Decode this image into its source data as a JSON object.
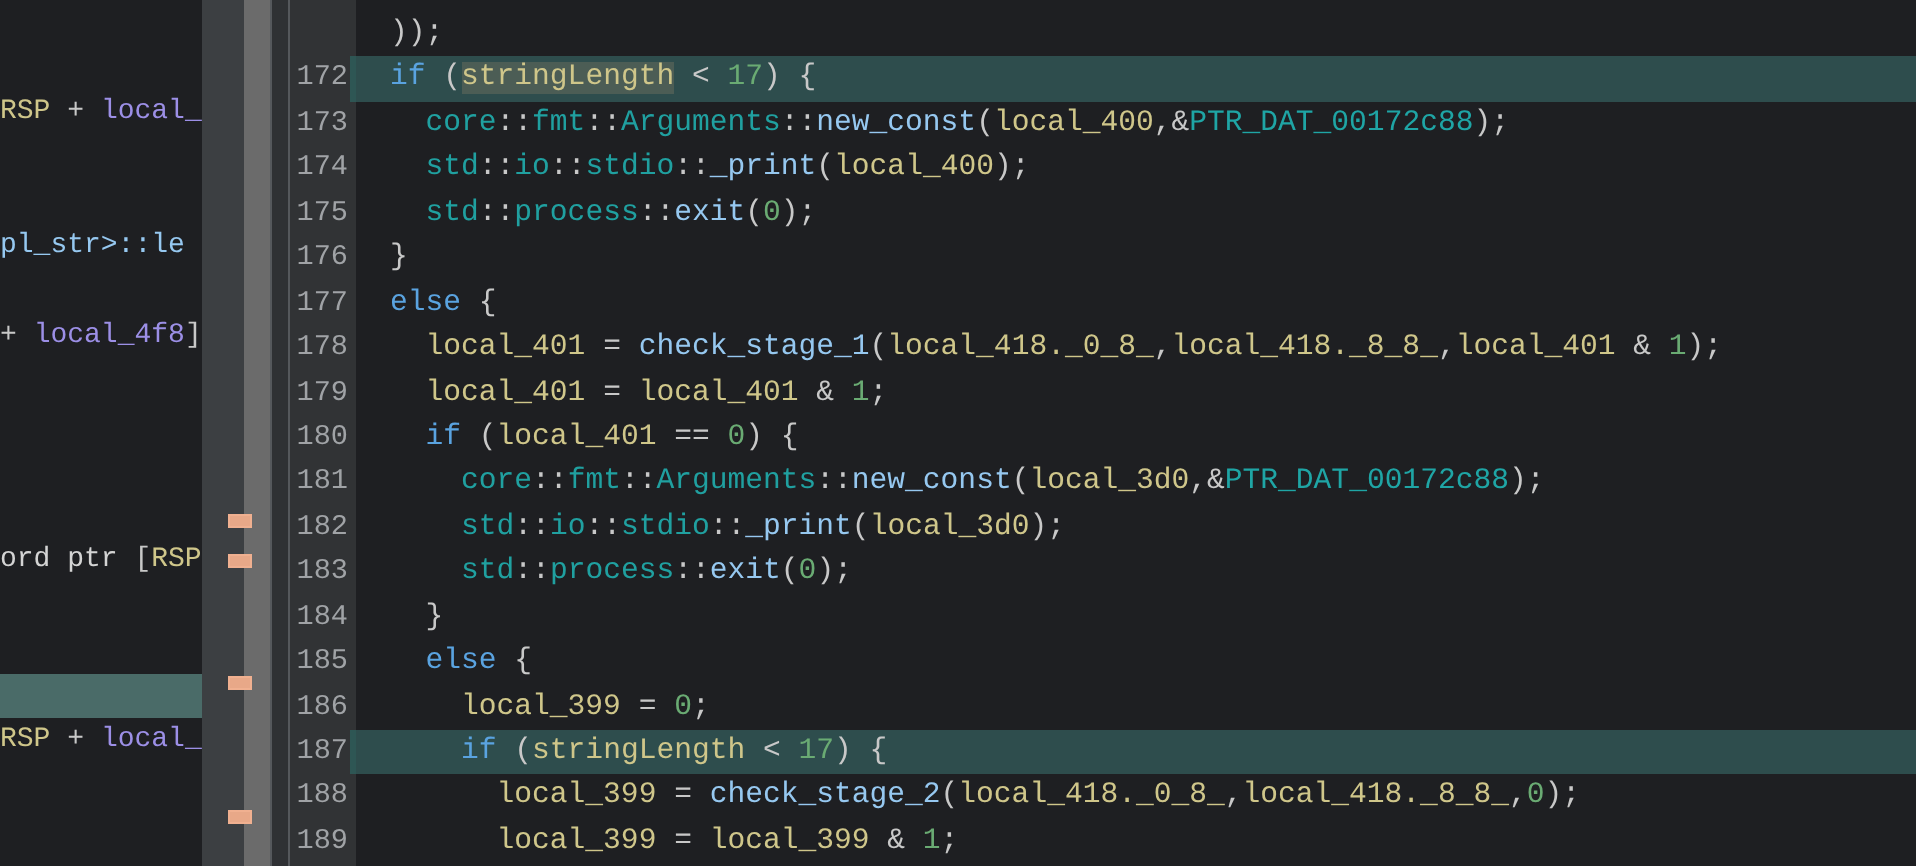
{
  "listing": {
    "rows": [
      {
        "kind": "blank"
      },
      {
        "kind": "blank"
      },
      {
        "kind": "code",
        "highlighted": false,
        "tokens": [
          {
            "text": "RSP",
            "kind": "register"
          },
          {
            "text": " + ",
            "kind": "punct"
          },
          {
            "text": "local_",
            "kind": "field"
          }
        ]
      },
      {
        "kind": "blank"
      },
      {
        "kind": "blank"
      },
      {
        "kind": "code",
        "highlighted": false,
        "tokens": [
          {
            "text": "pl_str>::le",
            "kind": "function"
          }
        ]
      },
      {
        "kind": "blank"
      },
      {
        "kind": "code",
        "highlighted": false,
        "tokens": [
          {
            "text": "+ ",
            "kind": "punct"
          },
          {
            "text": "local_4f8",
            "kind": "field"
          },
          {
            "text": "]",
            "kind": "punct"
          }
        ]
      },
      {
        "kind": "blank"
      },
      {
        "kind": "blank"
      },
      {
        "kind": "blank"
      },
      {
        "kind": "blank"
      },
      {
        "kind": "code",
        "highlighted": false,
        "tokens": [
          {
            "text": "ord ptr ",
            "kind": "plain"
          },
          {
            "text": "[",
            "kind": "punct"
          },
          {
            "text": "RSP",
            "kind": "register"
          }
        ]
      },
      {
        "kind": "blank"
      },
      {
        "kind": "blank"
      },
      {
        "kind": "blank",
        "highlighted": true
      },
      {
        "kind": "code",
        "highlighted": false,
        "tokens": [
          {
            "text": "RSP",
            "kind": "register"
          },
          {
            "text": " + ",
            "kind": "punct"
          },
          {
            "text": "local_",
            "kind": "field"
          }
        ]
      },
      {
        "kind": "blank"
      },
      {
        "kind": "blank"
      }
    ]
  },
  "decompiler": {
    "lines": [
      {
        "highlighted": false,
        "tokens": [
          {
            "text": "));",
            "kind": "punct"
          }
        ]
      },
      {
        "number": "172",
        "highlighted": true,
        "tokens": [
          {
            "text": "if",
            "kind": "keyword"
          },
          {
            "text": " (",
            "kind": "punct"
          },
          {
            "text": "stringLength",
            "kind": "variable",
            "marked": true
          },
          {
            "text": " < ",
            "kind": "punct"
          },
          {
            "text": "17",
            "kind": "number"
          },
          {
            "text": ") {",
            "kind": "punct"
          }
        ]
      },
      {
        "number": "173",
        "highlighted": false,
        "tokens": [
          {
            "text": "  core",
            "kind": "namespace"
          },
          {
            "text": "::",
            "kind": "punct"
          },
          {
            "text": "fmt",
            "kind": "namespace"
          },
          {
            "text": "::",
            "kind": "punct"
          },
          {
            "text": "Arguments",
            "kind": "namespace"
          },
          {
            "text": "::",
            "kind": "punct"
          },
          {
            "text": "new_const",
            "kind": "function"
          },
          {
            "text": "(",
            "kind": "punct"
          },
          {
            "text": "local_400",
            "kind": "variable"
          },
          {
            "text": ",&",
            "kind": "punct"
          },
          {
            "text": "PTR_DAT_00172c88",
            "kind": "constant"
          },
          {
            "text": ");",
            "kind": "punct"
          }
        ]
      },
      {
        "number": "174",
        "highlighted": false,
        "tokens": [
          {
            "text": "  std",
            "kind": "namespace"
          },
          {
            "text": "::",
            "kind": "punct"
          },
          {
            "text": "io",
            "kind": "namespace"
          },
          {
            "text": "::",
            "kind": "punct"
          },
          {
            "text": "stdio",
            "kind": "namespace"
          },
          {
            "text": "::",
            "kind": "punct"
          },
          {
            "text": "_print",
            "kind": "function"
          },
          {
            "text": "(",
            "kind": "punct"
          },
          {
            "text": "local_400",
            "kind": "variable"
          },
          {
            "text": ");",
            "kind": "punct"
          }
        ]
      },
      {
        "number": "175",
        "highlighted": false,
        "tokens": [
          {
            "text": "  std",
            "kind": "namespace"
          },
          {
            "text": "::",
            "kind": "punct"
          },
          {
            "text": "process",
            "kind": "namespace"
          },
          {
            "text": "::",
            "kind": "punct"
          },
          {
            "text": "exit",
            "kind": "function"
          },
          {
            "text": "(",
            "kind": "punct"
          },
          {
            "text": "0",
            "kind": "number"
          },
          {
            "text": ");",
            "kind": "punct"
          }
        ]
      },
      {
        "number": "176",
        "highlighted": false,
        "tokens": [
          {
            "text": "}",
            "kind": "punct"
          }
        ]
      },
      {
        "number": "177",
        "highlighted": false,
        "tokens": [
          {
            "text": "else",
            "kind": "keyword"
          },
          {
            "text": " {",
            "kind": "punct"
          }
        ]
      },
      {
        "number": "178",
        "highlighted": false,
        "tokens": [
          {
            "text": "  local_401",
            "kind": "variable"
          },
          {
            "text": " = ",
            "kind": "punct"
          },
          {
            "text": "check_stage_1",
            "kind": "function"
          },
          {
            "text": "(",
            "kind": "punct"
          },
          {
            "text": "local_418._0_8_",
            "kind": "variable"
          },
          {
            "text": ",",
            "kind": "punct"
          },
          {
            "text": "local_418._8_8_",
            "kind": "variable"
          },
          {
            "text": ",",
            "kind": "punct"
          },
          {
            "text": "local_401",
            "kind": "variable"
          },
          {
            "text": " & ",
            "kind": "punct"
          },
          {
            "text": "1",
            "kind": "number"
          },
          {
            "text": ");",
            "kind": "punct"
          }
        ]
      },
      {
        "number": "179",
        "highlighted": false,
        "tokens": [
          {
            "text": "  local_401",
            "kind": "variable"
          },
          {
            "text": " = ",
            "kind": "punct"
          },
          {
            "text": "local_401",
            "kind": "variable"
          },
          {
            "text": " & ",
            "kind": "punct"
          },
          {
            "text": "1",
            "kind": "number"
          },
          {
            "text": ";",
            "kind": "punct"
          }
        ]
      },
      {
        "number": "180",
        "highlighted": false,
        "tokens": [
          {
            "text": "  if",
            "kind": "keyword"
          },
          {
            "text": " (",
            "kind": "punct"
          },
          {
            "text": "local_401",
            "kind": "variable"
          },
          {
            "text": " == ",
            "kind": "punct"
          },
          {
            "text": "0",
            "kind": "number"
          },
          {
            "text": ") {",
            "kind": "punct"
          }
        ]
      },
      {
        "number": "181",
        "highlighted": false,
        "tokens": [
          {
            "text": "    core",
            "kind": "namespace"
          },
          {
            "text": "::",
            "kind": "punct"
          },
          {
            "text": "fmt",
            "kind": "namespace"
          },
          {
            "text": "::",
            "kind": "punct"
          },
          {
            "text": "Arguments",
            "kind": "namespace"
          },
          {
            "text": "::",
            "kind": "punct"
          },
          {
            "text": "new_const",
            "kind": "function"
          },
          {
            "text": "(",
            "kind": "punct"
          },
          {
            "text": "local_3d0",
            "kind": "variable"
          },
          {
            "text": ",&",
            "kind": "punct"
          },
          {
            "text": "PTR_DAT_00172c88",
            "kind": "constant"
          },
          {
            "text": ");",
            "kind": "punct"
          }
        ]
      },
      {
        "number": "182",
        "highlighted": false,
        "tokens": [
          {
            "text": "    std",
            "kind": "namespace"
          },
          {
            "text": "::",
            "kind": "punct"
          },
          {
            "text": "io",
            "kind": "namespace"
          },
          {
            "text": "::",
            "kind": "punct"
          },
          {
            "text": "stdio",
            "kind": "namespace"
          },
          {
            "text": "::",
            "kind": "punct"
          },
          {
            "text": "_print",
            "kind": "function"
          },
          {
            "text": "(",
            "kind": "punct"
          },
          {
            "text": "local_3d0",
            "kind": "variable"
          },
          {
            "text": ");",
            "kind": "punct"
          }
        ]
      },
      {
        "number": "183",
        "highlighted": false,
        "tokens": [
          {
            "text": "    std",
            "kind": "namespace"
          },
          {
            "text": "::",
            "kind": "punct"
          },
          {
            "text": "process",
            "kind": "namespace"
          },
          {
            "text": "::",
            "kind": "punct"
          },
          {
            "text": "exit",
            "kind": "function"
          },
          {
            "text": "(",
            "kind": "punct"
          },
          {
            "text": "0",
            "kind": "number"
          },
          {
            "text": ");",
            "kind": "punct"
          }
        ]
      },
      {
        "number": "184",
        "highlighted": false,
        "tokens": [
          {
            "text": "  }",
            "kind": "punct"
          }
        ]
      },
      {
        "number": "185",
        "highlighted": false,
        "tokens": [
          {
            "text": "  else",
            "kind": "keyword"
          },
          {
            "text": " {",
            "kind": "punct"
          }
        ]
      },
      {
        "number": "186",
        "highlighted": false,
        "tokens": [
          {
            "text": "    local_399",
            "kind": "variable"
          },
          {
            "text": " = ",
            "kind": "punct"
          },
          {
            "text": "0",
            "kind": "number"
          },
          {
            "text": ";",
            "kind": "punct"
          }
        ]
      },
      {
        "number": "187",
        "highlighted": true,
        "tokens": [
          {
            "text": "    if",
            "kind": "keyword"
          },
          {
            "text": " (",
            "kind": "punct"
          },
          {
            "text": "stringLength",
            "kind": "variable"
          },
          {
            "text": " < ",
            "kind": "punct"
          },
          {
            "text": "17",
            "kind": "number"
          },
          {
            "text": ") {",
            "kind": "punct"
          }
        ]
      },
      {
        "number": "188",
        "highlighted": false,
        "tokens": [
          {
            "text": "      local_399",
            "kind": "variable"
          },
          {
            "text": " = ",
            "kind": "punct"
          },
          {
            "text": "check_stage_2",
            "kind": "function"
          },
          {
            "text": "(",
            "kind": "punct"
          },
          {
            "text": "local_418._0_8_",
            "kind": "variable"
          },
          {
            "text": ",",
            "kind": "punct"
          },
          {
            "text": "local_418._8_8_",
            "kind": "variable"
          },
          {
            "text": ",",
            "kind": "punct"
          },
          {
            "text": "0",
            "kind": "number"
          },
          {
            "text": ");",
            "kind": "punct"
          }
        ]
      },
      {
        "number": "189",
        "highlighted": false,
        "tokens": [
          {
            "text": "      local_399",
            "kind": "variable"
          },
          {
            "text": " = ",
            "kind": "punct"
          },
          {
            "text": "local_399",
            "kind": "variable"
          },
          {
            "text": " & ",
            "kind": "punct"
          },
          {
            "text": "1",
            "kind": "number"
          },
          {
            "text": ";",
            "kind": "punct"
          }
        ]
      }
    ]
  }
}
